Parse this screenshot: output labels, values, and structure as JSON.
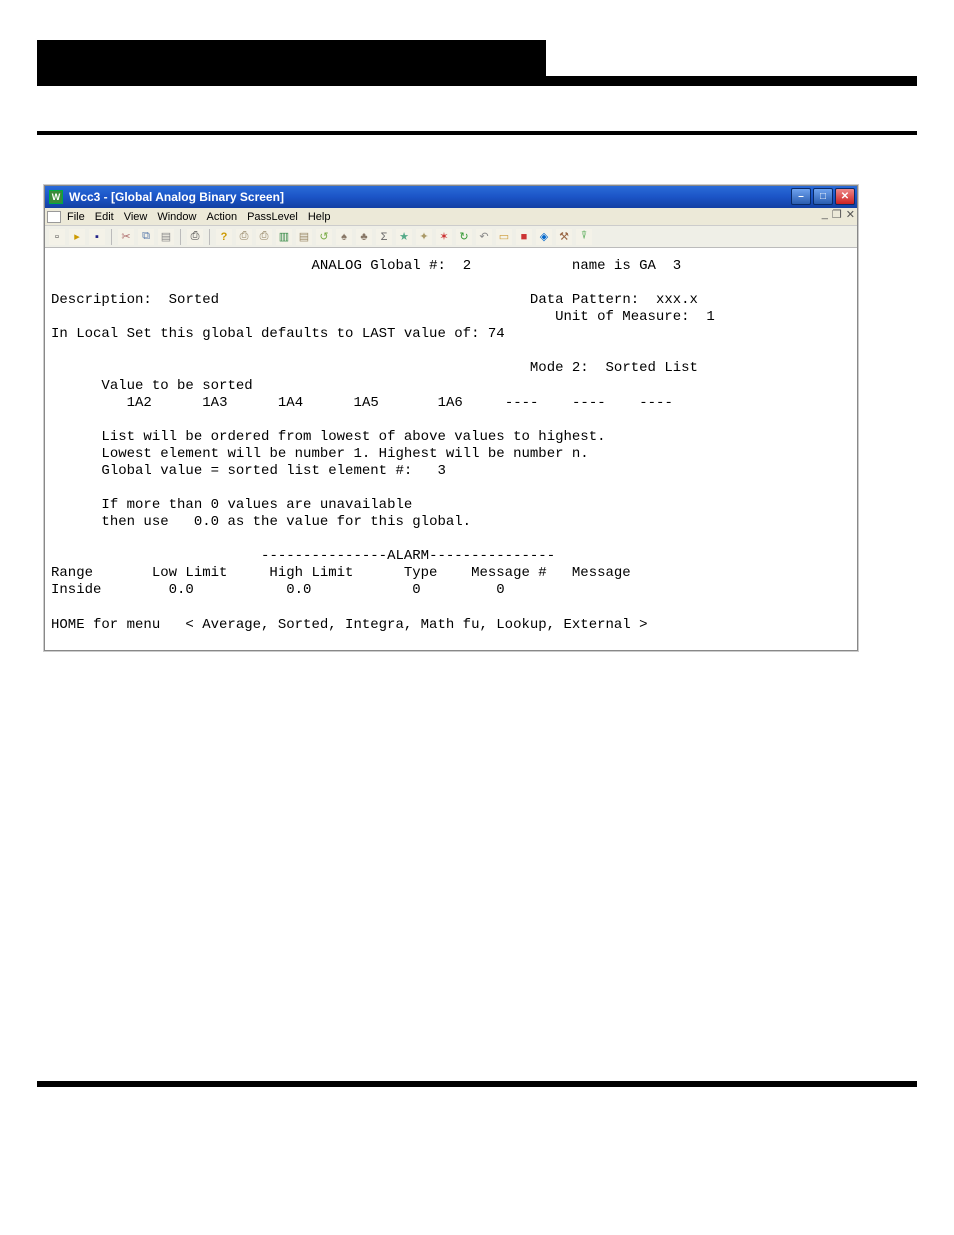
{
  "window": {
    "title": "Wcc3 - [Global Analog Binary Screen]",
    "appicon_letter": "W"
  },
  "menu": {
    "items": [
      "File",
      "Edit",
      "View",
      "Window",
      "Action",
      "PassLevel",
      "Help"
    ]
  },
  "toolbar": {
    "icons": [
      "new-icon",
      "open-icon",
      "save-icon",
      "cut-icon",
      "copy-icon",
      "paste-icon",
      "print-icon",
      "help-icon",
      "printer2-icon",
      "printer3-icon",
      "doc-icon",
      "copy2-icon",
      "refresh-icon",
      "bell-icon",
      "bell2-icon",
      "sigma-icon",
      "star-icon",
      "wand-icon",
      "star2-icon",
      "refresh2-icon",
      "back-icon",
      "box-icon",
      "stop-icon",
      "target-icon",
      "tool-icon",
      "tree-icon"
    ]
  },
  "screen": {
    "header_label": "ANALOG Global #:",
    "header_num": "2",
    "name_label": "name is GA",
    "name_num": "3",
    "desc_label": "Description:",
    "desc_value": "Sorted",
    "data_pattern_label": "Data Pattern:",
    "data_pattern_value": "xxx.x",
    "uom_label": "Unit of Measure:",
    "uom_value": "1",
    "local_set_line": "In Local Set this global defaults to LAST value of: 74",
    "mode_label": "Mode 2:",
    "mode_value": "Sorted List",
    "value_sorted_label": "Value to be sorted",
    "sort_items": [
      "1A2",
      "1A3",
      "1A4",
      "1A5",
      "1A6",
      "----",
      "----",
      "----"
    ],
    "body_line1": "List will be ordered from lowest of above values to highest.",
    "body_line2": "Lowest element will be number 1. Highest will be number n.",
    "body_line3_label": "Global value = sorted list element #:",
    "body_line3_value": "3",
    "unavail_line1": "If more than 0 values are unavailable",
    "unavail_line2": "then use   0.0 as the value for this global.",
    "alarm_divider": "---------------ALARM---------------",
    "alarm_headers": "Range       Low Limit     High Limit      Type    Message #   Message",
    "alarm_row": "Inside        0.0           0.0            0         0",
    "footer": "HOME for menu   < Average, Sorted, Integra, Math fu, Lookup, External >"
  }
}
